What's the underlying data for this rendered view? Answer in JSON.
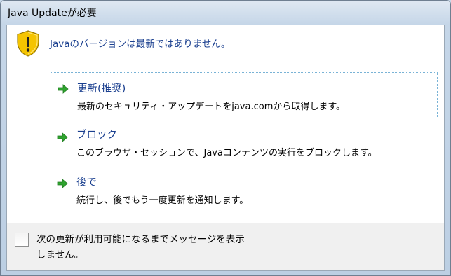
{
  "window": {
    "title": "Java Updateが必要"
  },
  "message": "Javaのバージョンは最新ではありません。",
  "options": [
    {
      "title": "更新(推奨)",
      "description": "最新のセキュリティ・アップデートをjava.comから取得します。",
      "icon": "green-arrow-icon"
    },
    {
      "title": "ブロック",
      "description": "このブラウザ・セッションで、Javaコンテンツの実行をブロックします。",
      "icon": "green-arrow-icon"
    },
    {
      "title": "後で",
      "description": "続行し、後でもう一度更新を通知します。",
      "icon": "green-arrow-icon"
    }
  ],
  "footer": {
    "checkbox_label_line1": "次の更新が利用可能になるまでメッセージを表示",
    "checkbox_label_line2": "しません。",
    "checked": false
  },
  "colors": {
    "accent_text": "#1a3f8f",
    "arrow_green": "#2fa32f",
    "warning_yellow": "#f5c400"
  }
}
